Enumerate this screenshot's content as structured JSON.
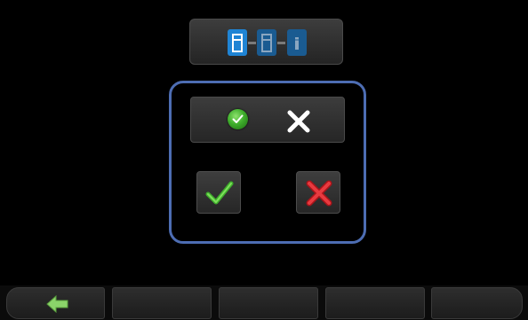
{
  "colors": {
    "background": "#000000",
    "panel_border": "#4d6db3",
    "mode_active": "#1f84d4",
    "mode_inactive": "#1a5b91",
    "accept_green": "#3fae2c",
    "reject_red": "#d42027",
    "back_arrow": "#8bd36a"
  },
  "mode_selector": {
    "icons": [
      "door-frame-icon",
      "door-frame-icon",
      "door-side-icon"
    ],
    "active_index": 0
  },
  "status": {
    "left_icon": "green-check-dot-icon",
    "right_icon": "white-x-icon"
  },
  "actions": {
    "accept_icon": "green-checkmark-icon",
    "reject_icon": "red-x-icon"
  },
  "softkeys": [
    {
      "icon": "back-arrow-icon"
    },
    {
      "icon": ""
    },
    {
      "icon": ""
    },
    {
      "icon": ""
    },
    {
      "icon": ""
    }
  ]
}
